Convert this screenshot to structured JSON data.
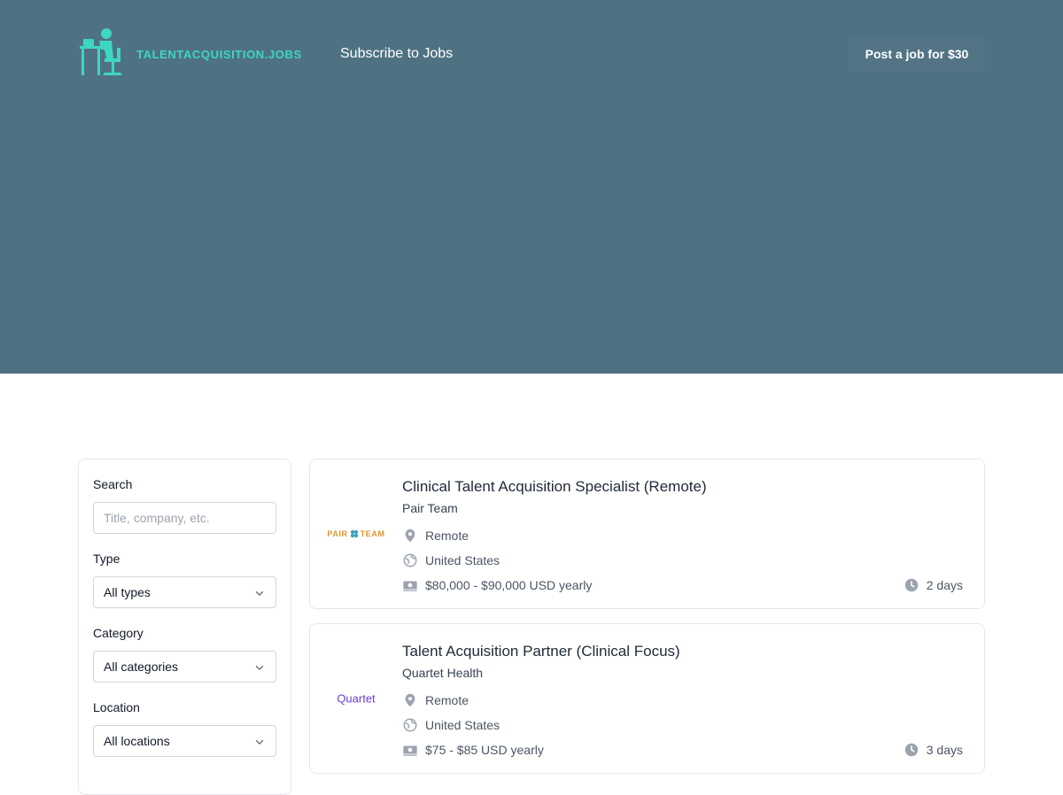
{
  "header": {
    "logo_text": "TALENTACQUISITION.JOBS",
    "subscribe_label": "Subscribe to Jobs",
    "post_job_label": "Post a job for $30"
  },
  "filters": {
    "search_label": "Search",
    "search_placeholder": "Title, company, etc.",
    "type_label": "Type",
    "type_value": "All types",
    "category_label": "Category",
    "category_value": "All categories",
    "location_label": "Location",
    "location_value": "All locations"
  },
  "jobs": [
    {
      "title": "Clinical Talent Acquisition Specialist (Remote)",
      "company": "Pair Team",
      "logo_text_left": "PAIR",
      "logo_text_right": "TEAM",
      "location": "Remote",
      "country": "United States",
      "salary": "$80,000 - $90,000 USD yearly",
      "age": "2 days"
    },
    {
      "title": "Talent Acquisition Partner (Clinical Focus)",
      "company": "Quartet Health",
      "logo_text": "Quartet",
      "location": "Remote",
      "country": "United States",
      "salary": "$75 - $85 USD yearly",
      "age": "3 days"
    }
  ],
  "colors": {
    "hero_bg": "#4f7283",
    "logo_accent": "#3dd6c2",
    "pair_logo": "#e0962e",
    "quartet_logo": "#6b3fd6"
  },
  "icons": [
    "desk-person-icon",
    "map-pin-icon",
    "globe-icon",
    "banknote-icon",
    "clock-icon",
    "chevron-down-icon"
  ]
}
